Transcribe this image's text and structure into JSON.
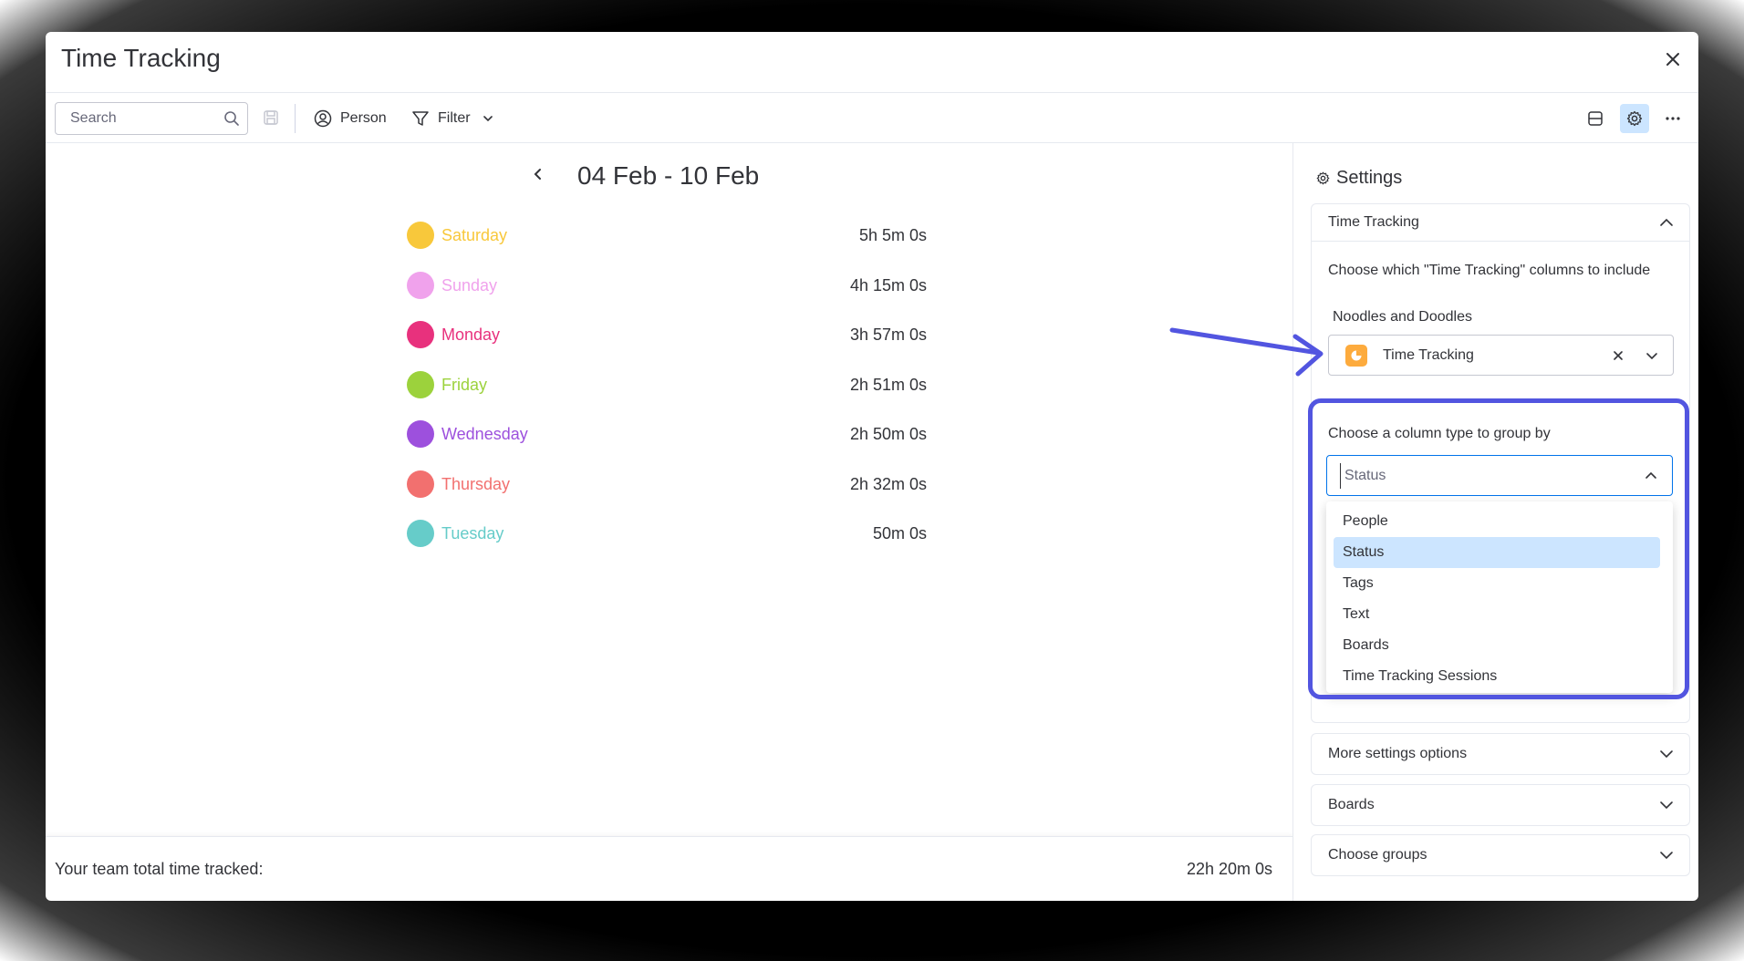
{
  "window": {
    "title": "Time Tracking"
  },
  "toolbar": {
    "search_placeholder": "Search",
    "person_label": "Person",
    "filter_label": "Filter"
  },
  "week": {
    "label": "04 Feb - 10 Feb"
  },
  "days": [
    {
      "name": "Saturday",
      "time": "5h 5m 0s",
      "color": "#f8c83b"
    },
    {
      "name": "Sunday",
      "time": "4h 15m 0s",
      "color": "#f0a2ec"
    },
    {
      "name": "Monday",
      "time": "3h 57m 0s",
      "color": "#e8317d"
    },
    {
      "name": "Friday",
      "time": "2h 51m 0s",
      "color": "#9cd23c"
    },
    {
      "name": "Wednesday",
      "time": "2h 50m 0s",
      "color": "#9d50dd"
    },
    {
      "name": "Thursday",
      "time": "2h 32m 0s",
      "color": "#f2706f"
    },
    {
      "name": "Tuesday",
      "time": "50m 0s",
      "color": "#66ccc9"
    }
  ],
  "footer": {
    "label": "Your team total time tracked:",
    "total": "22h 20m 0s"
  },
  "settings": {
    "title": "Settings",
    "time_tracking": {
      "header": "Time Tracking",
      "columns_prompt": "Choose which \"Time Tracking\" columns to include",
      "board_name": "Noodles and Doodles",
      "column_value": "Time Tracking",
      "group_prompt": "Choose a column type to group by",
      "group_placeholder": "Status",
      "group_options": [
        "People",
        "Status",
        "Tags",
        "Text",
        "Boards",
        "Time Tracking Sessions"
      ],
      "group_selected": "Status"
    },
    "more_settings": "More settings options",
    "boards": "Boards",
    "choose_groups": "Choose groups"
  },
  "colors": {
    "accent": "#0073ea",
    "annotation": "#5255e0",
    "selected_bg": "#cce5ff"
  }
}
